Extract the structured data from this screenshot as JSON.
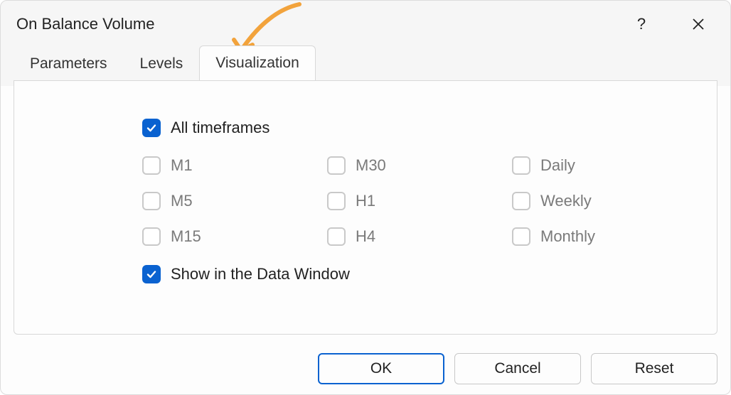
{
  "title": "On Balance Volume",
  "tabs": {
    "parameters": "Parameters",
    "levels": "Levels",
    "visualization": "Visualization"
  },
  "checks": {
    "all_timeframes": "All timeframes",
    "m1": "M1",
    "m5": "M5",
    "m15": "M15",
    "m30": "M30",
    "h1": "H1",
    "h4": "H4",
    "daily": "Daily",
    "weekly": "Weekly",
    "monthly": "Monthly",
    "show_data_window": "Show in the Data Window"
  },
  "buttons": {
    "ok": "OK",
    "cancel": "Cancel",
    "reset": "Reset"
  },
  "help_char": "?"
}
